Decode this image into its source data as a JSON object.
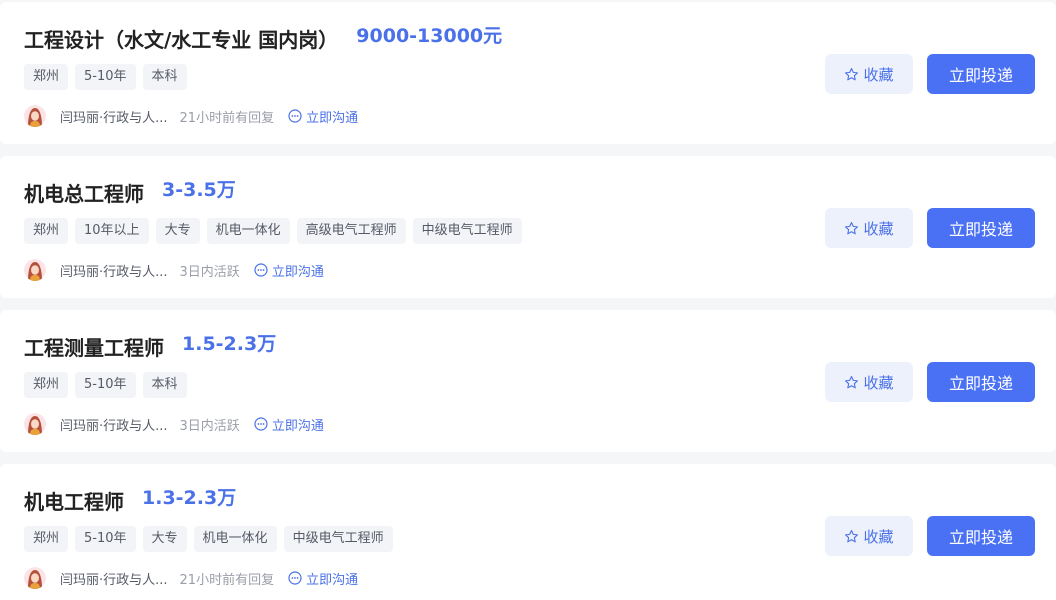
{
  "jobs": [
    {
      "title": "工程设计（水文/水工专业 国内岗）",
      "salary": "9000-13000元",
      "tags": [
        "郑州",
        "5-10年",
        "本科"
      ],
      "recruiter": "闫玛丽·行政与人...",
      "status": "21小时前有回复",
      "chat_label": "立即沟通",
      "fav_label": "收藏",
      "apply_label": "立即投递"
    },
    {
      "title": "机电总工程师",
      "salary": "3-3.5万",
      "tags": [
        "郑州",
        "10年以上",
        "大专",
        "机电一体化",
        "高级电气工程师",
        "中级电气工程师"
      ],
      "recruiter": "闫玛丽·行政与人...",
      "status": "3日内活跃",
      "chat_label": "立即沟通",
      "fav_label": "收藏",
      "apply_label": "立即投递"
    },
    {
      "title": "工程测量工程师",
      "salary": "1.5-2.3万",
      "tags": [
        "郑州",
        "5-10年",
        "本科"
      ],
      "recruiter": "闫玛丽·行政与人...",
      "status": "3日内活跃",
      "chat_label": "立即沟通",
      "fav_label": "收藏",
      "apply_label": "立即投递"
    },
    {
      "title": "机电工程师",
      "salary": "1.3-2.3万",
      "tags": [
        "郑州",
        "5-10年",
        "大专",
        "机电一体化",
        "中级电气工程师"
      ],
      "recruiter": "闫玛丽·行政与人...",
      "status": "21小时前有回复",
      "chat_label": "立即沟通",
      "fav_label": "收藏",
      "apply_label": "立即投递"
    }
  ],
  "icons": {
    "favorite": "star-outline-icon",
    "chat": "chat-bubble-icon",
    "avatar": "recruiter-avatar"
  },
  "colors": {
    "accent": "#4a71e8",
    "apply_button": "#4a71f4",
    "fav_button_bg": "#edf1fc",
    "tag_bg": "#f3f4f7",
    "page_bg": "#f5f6f8"
  }
}
